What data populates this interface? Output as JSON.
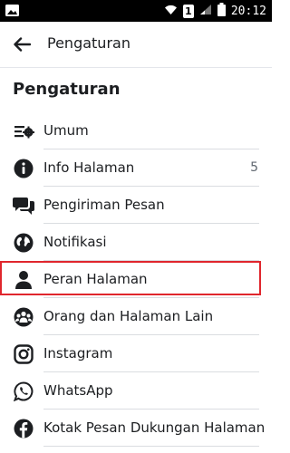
{
  "status_bar": {
    "time": "20:12",
    "sim_label": "1"
  },
  "app_bar": {
    "title": "Pengaturan"
  },
  "section": {
    "title": "Pengaturan"
  },
  "items": [
    {
      "label": "Umum",
      "icon": "sliders-gear-icon"
    },
    {
      "label": "Info Halaman",
      "count": "5",
      "icon": "info-icon"
    },
    {
      "label": "Pengiriman Pesan",
      "icon": "chat-bubbles-icon"
    },
    {
      "label": "Notifikasi",
      "icon": "globe-icon"
    },
    {
      "label": "Peran Halaman",
      "icon": "person-icon"
    },
    {
      "label": "Orang dan Halaman Lain",
      "icon": "people-group-icon"
    },
    {
      "label": "Instagram",
      "icon": "instagram-icon"
    },
    {
      "label": "WhatsApp",
      "icon": "whatsapp-icon"
    },
    {
      "label": "Kotak Pesan Dukungan Halaman",
      "icon": "facebook-icon"
    }
  ],
  "colors": {
    "highlight_border": "#e0262d",
    "icon": "#1c1e21",
    "status_bar": "#000000"
  }
}
